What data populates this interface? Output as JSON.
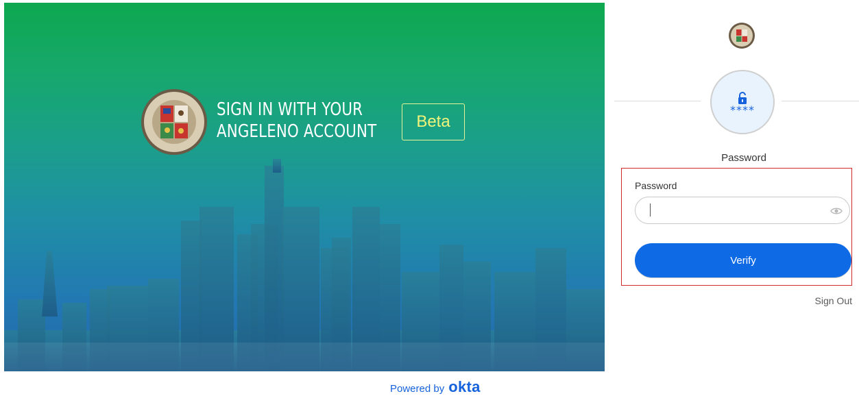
{
  "hero": {
    "title_line1": "SIGN IN WITH YOUR",
    "title_line2": "ANGELENO ACCOUNT",
    "badge": "Beta",
    "gradient_top": "#0ea84f",
    "gradient_bottom": "#2468ad"
  },
  "footer": {
    "powered_label": "Powered by",
    "brand": "okta"
  },
  "login": {
    "factor_symbol": "****",
    "factor_title": "Password",
    "field_label": "Password",
    "password_value": "",
    "verify_label": "Verify",
    "sign_out_label": "Sign Out",
    "accent_color": "#0f6ae6",
    "highlight_color": "#cd2b2b"
  },
  "icons": {
    "seal_large": "city-seal-icon",
    "seal_small": "city-seal-icon",
    "factor": "unlock-icon",
    "show_password": "eye-icon"
  }
}
